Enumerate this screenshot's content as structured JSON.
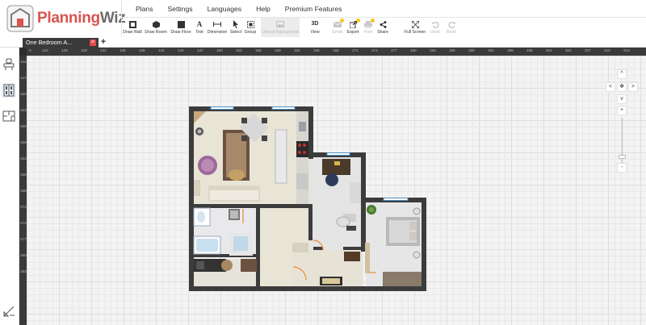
{
  "app": {
    "brand_main": "Planning",
    "brand_accent": "Wiz",
    "accent_color": "#d9534f"
  },
  "menu": {
    "items": [
      "Plans",
      "Settings",
      "Languages",
      "Help",
      "Premium Features"
    ]
  },
  "toolbar": {
    "tools": [
      {
        "label": "Draw Wall",
        "icon": "draw-wall-icon",
        "enabled": true
      },
      {
        "label": "Draw Room",
        "icon": "draw-room-icon",
        "enabled": true
      },
      {
        "label": "Draw Floor",
        "icon": "draw-floor-icon",
        "enabled": true
      },
      {
        "label": "Text",
        "icon": "text-icon",
        "enabled": true
      },
      {
        "label": "Dimension",
        "icon": "dimension-icon",
        "enabled": true
      },
      {
        "label": "Select",
        "icon": "select-cursor-icon",
        "enabled": true
      },
      {
        "label": "Group",
        "icon": "group-icon",
        "enabled": true
      },
      {
        "label": "Upload Background",
        "icon": "upload-background-icon",
        "enabled": false
      },
      {
        "label": "View",
        "icon": "3d-view-icon",
        "icon_text": "3D",
        "enabled": true
      },
      {
        "label": "Email",
        "icon": "email-icon",
        "enabled": false
      },
      {
        "label": "Export",
        "icon": "export-icon",
        "enabled": true
      },
      {
        "label": "Print",
        "icon": "print-icon",
        "enabled": false
      },
      {
        "label": "Share",
        "icon": "share-icon",
        "enabled": true
      },
      {
        "label": "Full Screen",
        "icon": "fullscreen-icon",
        "enabled": true
      },
      {
        "label": "Undo",
        "icon": "undo-icon",
        "enabled": false
      },
      {
        "label": "Redo",
        "icon": "redo-icon",
        "enabled": false
      }
    ]
  },
  "tabs": [
    {
      "label": "One Bedroom A...",
      "close": "×"
    }
  ],
  "tab_add": "+",
  "ruler": {
    "top": [
      "0",
      "123",
      "126",
      "129",
      "132",
      "135",
      "138",
      "141",
      "144",
      "147",
      "150",
      "153",
      "156",
      "159",
      "162",
      "165",
      "168",
      "171",
      "174",
      "177",
      "180",
      "183",
      "186",
      "189",
      "192",
      "195",
      "198",
      "201",
      "204",
      "207",
      "210",
      "213"
    ],
    "left": [
      "144",
      "147",
      "150",
      "153",
      "156",
      "159",
      "162",
      "165",
      "168",
      "171",
      "174",
      "177",
      "180",
      "183"
    ]
  },
  "nav": {
    "up": "^",
    "down": "v",
    "left": "<",
    "right": ">",
    "zoom_in": "+",
    "zoom_out": "-"
  },
  "zoom_level": 0.18
}
